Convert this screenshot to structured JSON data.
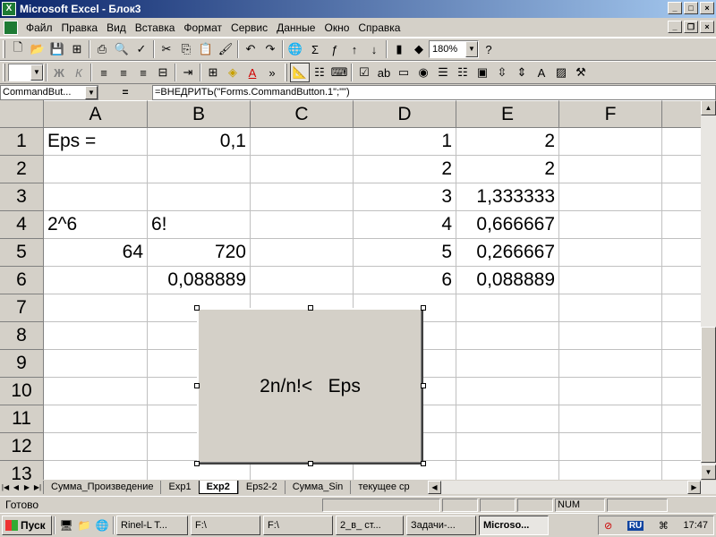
{
  "window": {
    "title": "Microsoft Excel - Блок3",
    "app_icon": "excel-icon",
    "controls": [
      "minimize",
      "maximize",
      "close"
    ]
  },
  "menu": {
    "items": [
      "Файл",
      "Правка",
      "Вид",
      "Вставка",
      "Формат",
      "Сервис",
      "Данные",
      "Окно",
      "Справка"
    ]
  },
  "toolbar": {
    "zoom": "180%"
  },
  "formula_bar": {
    "name_box": "CommandBut...",
    "equals": "=",
    "formula": "=ВНЕДРИТЬ(\"Forms.CommandButton.1\";\"\")"
  },
  "grid": {
    "columns": [
      "A",
      "B",
      "C",
      "D",
      "E",
      "F"
    ],
    "rows": [
      "1",
      "2",
      "3",
      "4",
      "5",
      "6",
      "7",
      "8",
      "9",
      "10",
      "11",
      "12",
      "13"
    ],
    "cells": {
      "A1": "Eps =",
      "B1": "0,1",
      "D1": "1",
      "E1": "2",
      "D2": "2",
      "E2": "2",
      "D3": "3",
      "E3": "1,333333",
      "A4": "2^6",
      "B4": "6!",
      "D4": "4",
      "E4": "0,666667",
      "A5": "64",
      "B5": "720",
      "D5": "5",
      "E5": "0,266667",
      "B6": "0,088889",
      "D6": "6",
      "E6": "0,088889"
    }
  },
  "command_button": {
    "label": "2n/n!<   Eps"
  },
  "sheet_tabs": {
    "items": [
      "Сумма_Произведение",
      "Exp1",
      "Exp2",
      "Eps2-2",
      "Сумма_Sin",
      "текущее ср"
    ],
    "active": "Exp2"
  },
  "status": {
    "text": "Готово",
    "num": "NUM"
  },
  "taskbar": {
    "start": "Пуск",
    "items": [
      "Rinel-L T...",
      "F:\\",
      "F:\\",
      "2_в_ ст...",
      "Задачи-...",
      "Microso..."
    ],
    "active": "Microso...",
    "lang": "RU",
    "clock": "17:47"
  }
}
